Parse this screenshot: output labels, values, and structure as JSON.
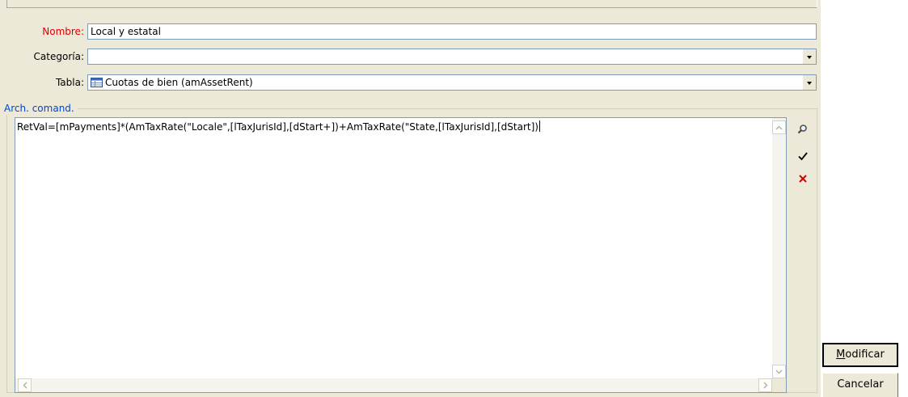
{
  "form": {
    "name_label": "Nombre:",
    "name_value": "Local y estatal",
    "category_label": "Categoría:",
    "category_value": "",
    "table_label": "Tabla:",
    "table_value": "Cuotas de bien (amAssetRent)",
    "table_icon": "table-icon"
  },
  "script_group": {
    "title": "Arch. comand.",
    "code": "RetVal=[mPayments]*(AmTaxRate(\"Locale\",[lTaxJurisId],[dStart+])+AmTaxRate(\"State,[lTaxJurisId],[dStart])"
  },
  "side_tools": {
    "search_icon": "magnifier-icon",
    "check_icon": "checkmark-icon",
    "clear_icon": "red-x-icon"
  },
  "buttons": {
    "modify_mnemonic": "M",
    "modify_rest": "odificar",
    "cancel_label": "Cancelar"
  },
  "colors": {
    "panel_bg": "#ece9d8",
    "required_label": "#e00000",
    "group_title": "#0046d5"
  }
}
